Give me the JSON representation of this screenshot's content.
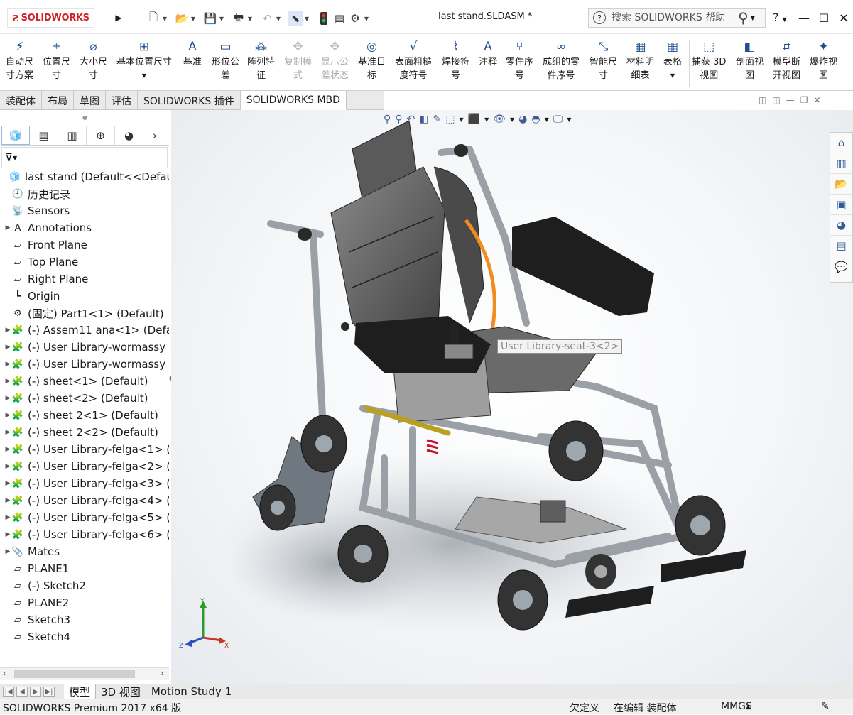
{
  "app": {
    "logo": "SOLIDWORKS",
    "document_title": "last stand.SLDASM *",
    "search_placeholder": "搜索 SOLIDWORKS 帮助",
    "help": "?"
  },
  "ribbon": {
    "items": [
      {
        "label": "自动尺\n寸方案",
        "icon": "auto-dimension-icon",
        "enabled": true
      },
      {
        "label": "位置尺\n寸",
        "icon": "location-dimension-icon",
        "enabled": true
      },
      {
        "label": "大小尺\n寸",
        "icon": "size-dimension-icon",
        "enabled": true
      },
      {
        "label": "基本位置尺寸",
        "icon": "basic-location-dimension-icon",
        "enabled": true
      },
      {
        "label": "基准",
        "icon": "datum-icon",
        "enabled": true
      },
      {
        "label": "形位公\n差",
        "icon": "geometric-tolerance-icon",
        "enabled": true
      },
      {
        "label": "阵列特\n征",
        "icon": "pattern-feature-icon",
        "enabled": true
      },
      {
        "label": "复制模\n式",
        "icon": "copy-scheme-icon",
        "enabled": false
      },
      {
        "label": "显示公\n差状态",
        "icon": "show-tolerance-status-icon",
        "enabled": false
      },
      {
        "label": "基准目\n标",
        "icon": "datum-target-icon",
        "enabled": true
      },
      {
        "label": "表面粗糙\n度符号",
        "icon": "surface-finish-icon",
        "enabled": true
      },
      {
        "label": "焊接符\n号",
        "icon": "weld-symbol-icon",
        "enabled": true
      },
      {
        "label": "注释",
        "icon": "note-icon",
        "enabled": true
      },
      {
        "label": "零件序\n号",
        "icon": "balloon-icon",
        "enabled": true
      },
      {
        "label": "成组的零\n件序号",
        "icon": "stacked-balloon-icon",
        "enabled": true
      },
      {
        "label": "智能尺\n寸",
        "icon": "smart-dimension-icon",
        "enabled": true
      },
      {
        "label": "材料明\n细表",
        "icon": "bom-icon",
        "enabled": true
      },
      {
        "label": "表格",
        "icon": "table-icon",
        "enabled": true
      },
      {
        "label": "捕获 3D\n视图",
        "icon": "capture-3d-view-icon",
        "enabled": true
      },
      {
        "label": "剖面视\n图",
        "icon": "section-view-icon",
        "enabled": true
      },
      {
        "label": "模型断\n开视图",
        "icon": "model-break-view-icon",
        "enabled": true
      },
      {
        "label": "爆炸视\n图",
        "icon": "exploded-view-icon",
        "enabled": true
      }
    ]
  },
  "command_tabs": [
    "装配体",
    "布局",
    "草图",
    "评估",
    "SOLIDWORKS 插件",
    "SOLIDWORKS MBD"
  ],
  "feature_tree": {
    "items": [
      {
        "label": "last stand  (Default<<Default>",
        "icon": "assembly-icon",
        "expand": false
      },
      {
        "label": "历史记录",
        "icon": "history-icon",
        "expand": false
      },
      {
        "label": "Sensors",
        "icon": "sensors-icon",
        "expand": false
      },
      {
        "label": "Annotations",
        "icon": "annotations-icon",
        "expand": true
      },
      {
        "label": "Front Plane",
        "icon": "plane-icon",
        "expand": false
      },
      {
        "label": "Top Plane",
        "icon": "plane-icon",
        "expand": false
      },
      {
        "label": "Right Plane",
        "icon": "plane-icon",
        "expand": false
      },
      {
        "label": "Origin",
        "icon": "origin-icon",
        "expand": false
      },
      {
        "label": "(固定) Part1<1> (Default)",
        "icon": "part-icon",
        "expand": false
      },
      {
        "label": "(-) Assem11 ana<1> (Defa",
        "icon": "subassembly-icon",
        "expand": true
      },
      {
        "label": "(-) User Library-wormassy",
        "icon": "subassembly-icon",
        "expand": true
      },
      {
        "label": "(-) User Library-wormassy",
        "icon": "subassembly-icon",
        "expand": true
      },
      {
        "label": "(-) sheet<1> (Default)",
        "icon": "subassembly-icon",
        "expand": true
      },
      {
        "label": "(-) sheet<2> (Default)",
        "icon": "subassembly-icon",
        "expand": true
      },
      {
        "label": "(-) sheet 2<1> (Default)",
        "icon": "subassembly-icon",
        "expand": true
      },
      {
        "label": "(-) sheet 2<2> (Default)",
        "icon": "subassembly-icon",
        "expand": true
      },
      {
        "label": "(-) User Library-felga<1> (",
        "icon": "subassembly-icon",
        "expand": true
      },
      {
        "label": "(-) User Library-felga<2> (",
        "icon": "subassembly-icon",
        "expand": true
      },
      {
        "label": "(-) User Library-felga<3> (",
        "icon": "subassembly-icon",
        "expand": true
      },
      {
        "label": "(-) User Library-felga<4> (",
        "icon": "subassembly-icon",
        "expand": true
      },
      {
        "label": "(-) User Library-felga<5> (",
        "icon": "subassembly-icon",
        "expand": true
      },
      {
        "label": "(-) User Library-felga<6> (",
        "icon": "subassembly-icon",
        "expand": true
      },
      {
        "label": "Mates",
        "icon": "mates-icon",
        "expand": true
      },
      {
        "label": "PLANE1",
        "icon": "plane-icon",
        "expand": false
      },
      {
        "label": "(-) Sketch2",
        "icon": "sketch-icon",
        "expand": false
      },
      {
        "label": "PLANE2",
        "icon": "plane-icon",
        "expand": false
      },
      {
        "label": "Sketch3",
        "icon": "sketch-icon",
        "expand": false
      },
      {
        "label": "Sketch4",
        "icon": "sketch-icon",
        "expand": false
      }
    ]
  },
  "viewport": {
    "tooltip": "User Library-seat-3<2>",
    "triad": {
      "y": "Y",
      "z": "Z",
      "x": "X"
    }
  },
  "bottom_tabs": [
    "模型",
    "3D 视图",
    "Motion Study 1"
  ],
  "status_bar": {
    "product": "SOLIDWORKS Premium 2017 x64 版",
    "definition": "欠定义",
    "mode": "在编辑 装配体",
    "units": "MMGS"
  },
  "colors": {
    "brand_red": "#d1232a",
    "accent_blue": "#1f4f8f",
    "seat_orange": "#f28c1f"
  }
}
